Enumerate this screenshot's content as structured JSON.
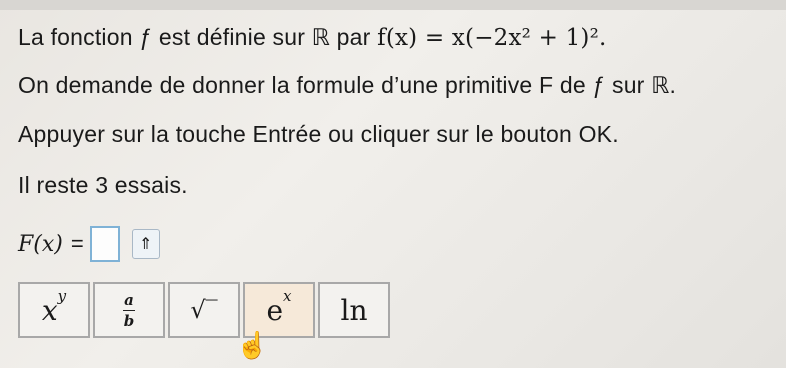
{
  "problem": {
    "line1_text": "La fonction ƒ est définie sur ℝ par ",
    "line1_formula": "f(x) = x(−2x² + 1)².",
    "line2": "On demande de donner la formule d’une primitive F de ƒ sur ℝ.",
    "line3": "Appuyer sur la touche Entrée ou cliquer sur le bouton OK.",
    "line4": "Il reste 3 essais."
  },
  "answer": {
    "label": "F(x)",
    "equals": "=",
    "value": "",
    "shift_symbol": "⇑"
  },
  "toolbar": {
    "power": {
      "base": "x",
      "exp": "y"
    },
    "fraction": {
      "num": "a",
      "den": "b"
    },
    "sqrt": "√‾",
    "exp": {
      "base": "e",
      "exp": "x"
    },
    "ln": "ln"
  },
  "colors": {
    "input_border": "#7fb2d6",
    "active_tool": "#f6e9d9"
  }
}
